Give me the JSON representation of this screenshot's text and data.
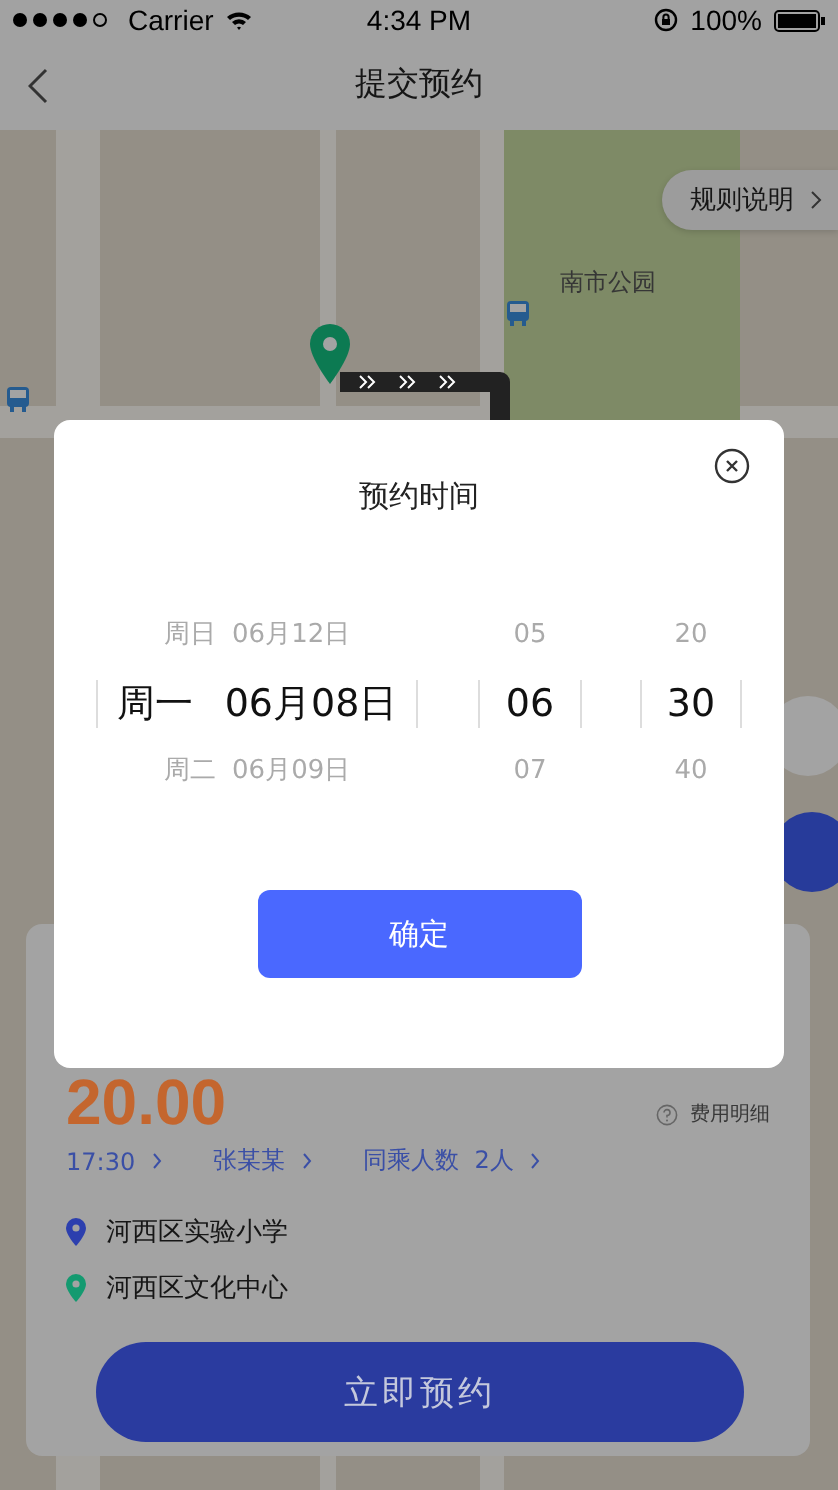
{
  "status_bar": {
    "carrier": "Carrier",
    "time": "4:34 PM",
    "battery": "100%"
  },
  "nav": {
    "title": "提交预约"
  },
  "map": {
    "rules_button": "规则说明",
    "poi_label": "南市公园"
  },
  "trip_card": {
    "price": "20.00",
    "fee_detail": "费用明细",
    "options": [
      {
        "label": "17:30"
      },
      {
        "label": "张某某"
      },
      {
        "label": "同乘人数  2人"
      }
    ],
    "places": [
      {
        "name": "河西区实验小学",
        "color": "#2c3fae"
      },
      {
        "name": "河西区文化中心",
        "color": "#149a70"
      }
    ],
    "submit": "立即预约"
  },
  "dialog": {
    "title": "预约时间",
    "confirm": "确定",
    "columns": [
      {
        "kind": "date",
        "items": [
          {
            "label": "周日 06月12日",
            "selected": false
          },
          {
            "label": "周一 06月08日",
            "selected": true
          },
          {
            "label": "周二 06月09日",
            "selected": false
          }
        ]
      },
      {
        "kind": "hour",
        "items": [
          {
            "label": "05",
            "selected": false
          },
          {
            "label": "06",
            "selected": true
          },
          {
            "label": "07",
            "selected": false
          }
        ]
      },
      {
        "kind": "minute",
        "items": [
          {
            "label": "20",
            "selected": false
          },
          {
            "label": "30",
            "selected": true
          },
          {
            "label": "40",
            "selected": false
          }
        ]
      }
    ]
  }
}
